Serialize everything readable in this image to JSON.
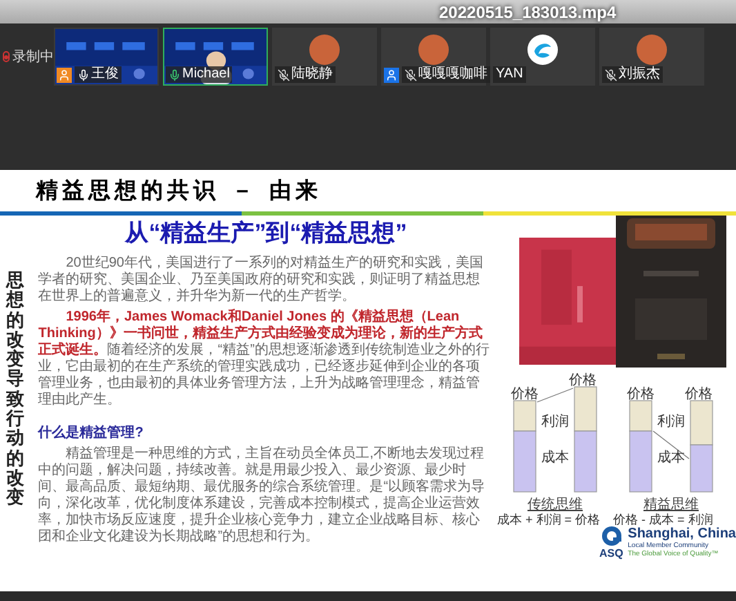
{
  "player": {
    "filename": "20220515_183013.mp4"
  },
  "recording": {
    "label": "录制中"
  },
  "participants": [
    {
      "name": "王俊",
      "kind": "video",
      "muted": false,
      "speaking": false,
      "color": "#f08a24"
    },
    {
      "name": "Michael",
      "kind": "video_person",
      "muted": false,
      "speaking": true
    },
    {
      "name": "陆晓静",
      "kind": "avatar",
      "muted": true,
      "speaking": false
    },
    {
      "name": "嘎嘎嘎咖啡",
      "kind": "avatar",
      "muted": true,
      "speaking": false,
      "color": "#1a73e8"
    },
    {
      "name": "YAN",
      "kind": "logo",
      "speaking": false
    },
    {
      "name": "刘振杰",
      "kind": "avatar",
      "muted": true,
      "speaking": false
    }
  ],
  "slide": {
    "title": "精益思想的共识 － 由来",
    "headline": "从“精益生产”到“精益思想”",
    "side_caption": "思想的改变导致行动的改变",
    "paragraphs": [
      {
        "text": "20世纪90年代，美国进行了一系列的对精益生产的研究和实践，美国学者的研究、美国企业、乃至美国政府的研究和实践，则证明了精益思想在世界上的普遍意义，并升华为新一代的生产哲学。"
      },
      {
        "highlight": "1996年，James Womack和Daniel Jones 的《精益思想（Lean Thinking）》一书问世，精益生产方式由经验变成为理论，新的生产方式正式诞生。",
        "text": "随着经济的发展，“精益”的思想逐渐渗透到传统制造业之外的行业，它由最初的在生产系统的管理实践成功，已经逐步延伸到企业的各项管理业务，也由最初的具体业务管理方法，上升为战略管理理念，精益管理由此产生。"
      }
    ],
    "question": "什么是精益管理?",
    "answer": "精益管理是一种思维的方式，主旨在动员全体员工,不断地去发现过程中的问题，解决问题，持续改善。就是用最少投入、最少资源、最少时间、最高品质、最短纳期、最优服务的综合系统管理。是“以顾客需求为导向，深化改革，优化制度体系建设，完善成本控制模式，提高企业运营效率，加快市场反应速度，提升企业核心竞争力，建立企业战略目标、核心团和企业文化建设为长期战略”的思想和行为。",
    "diagrams": [
      {
        "kind": "traditional",
        "price_labels": [
          "价格",
          "价格"
        ],
        "profit": "利润",
        "cost": "成本",
        "caption": "传统思维",
        "formula": "成本 + 利润 = 价格"
      },
      {
        "kind": "lean",
        "price_labels": [
          "价格",
          "价格"
        ],
        "profit": "利润",
        "cost": "成本",
        "caption": "精益思维",
        "formula": "价格 - 成本 = 利润"
      }
    ],
    "logo": {
      "mark": "ASQ",
      "city": "Shanghai, China",
      "line1": "Local Member Community",
      "line2": "The Global Voice of Quality™"
    }
  }
}
